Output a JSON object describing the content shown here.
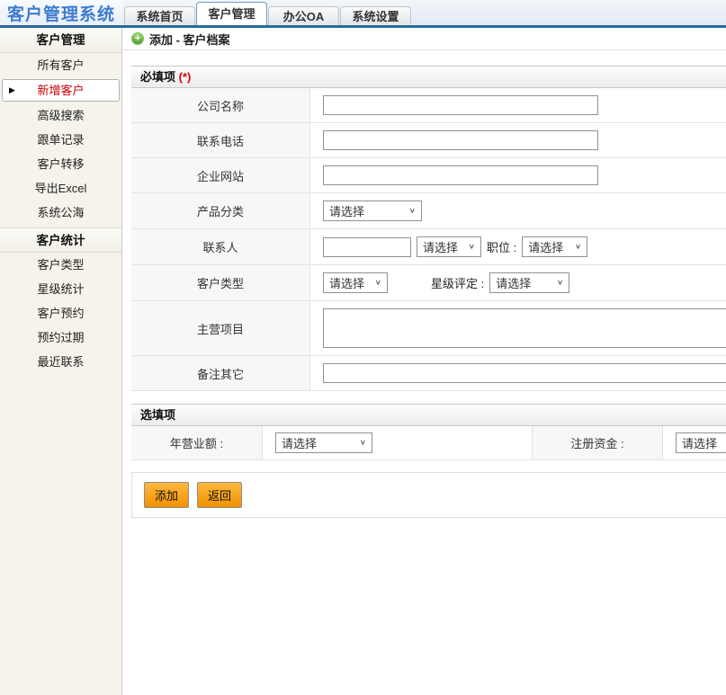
{
  "app": {
    "title": "客户管理系统"
  },
  "tabs": [
    {
      "label": "系统首页",
      "active": false
    },
    {
      "label": "客户管理",
      "active": true
    },
    {
      "label": "办公OA",
      "active": false
    },
    {
      "label": "系统设置",
      "active": false
    }
  ],
  "sidebar": {
    "sections": [
      {
        "header": "客户管理",
        "items": [
          {
            "label": "所有客户",
            "selected": false
          },
          {
            "label": "新增客户",
            "selected": true
          },
          {
            "label": "高级搜索",
            "selected": false
          },
          {
            "label": "跟单记录",
            "selected": false
          },
          {
            "label": "客户转移",
            "selected": false
          },
          {
            "label": "导出Excel",
            "selected": false
          },
          {
            "label": "系统公海",
            "selected": false
          }
        ]
      },
      {
        "header": "客户统计",
        "items": [
          {
            "label": "客户类型",
            "selected": false
          },
          {
            "label": "星级统计",
            "selected": false
          },
          {
            "label": "客户预约",
            "selected": false
          },
          {
            "label": "预约过期",
            "selected": false
          },
          {
            "label": "最近联系",
            "selected": false
          }
        ]
      }
    ]
  },
  "breadcrumb": {
    "label": "添加 - 客户档案"
  },
  "form": {
    "required": {
      "title": "必填项",
      "star": "(*)",
      "labels": {
        "company": "公司名称",
        "phone": "联系电话",
        "website": "企业网站",
        "category": "产品分类",
        "contact": "联系人",
        "position": "职位 :",
        "customer_type": "客户类型",
        "star_rating": "星级评定 :",
        "main_business": "主营项目",
        "remark": "备注其它"
      },
      "values": {
        "company": "",
        "phone": "",
        "website": "",
        "contact_name": "",
        "main_business": "",
        "remark": ""
      }
    },
    "optional": {
      "title": "选填项",
      "labels": {
        "annual_revenue": "年营业额 :",
        "registered_capital": "注册资金 :"
      }
    },
    "select_placeholder": "请选择",
    "buttons": [
      {
        "label": "添加"
      },
      {
        "label": "返回"
      }
    ]
  },
  "icons": {
    "plus": "+",
    "arrow_right": "▶",
    "chevron_down": "∨"
  },
  "colors": {
    "header_line_blue": "#2b6a99",
    "title_blue": "#3d7cd0",
    "selected_item_red": "#cc0000",
    "button_orange": "#f5a623",
    "breadcrumb_icon_green": "#4e9e2e",
    "label_cell_gray": "#f7f7f7"
  }
}
